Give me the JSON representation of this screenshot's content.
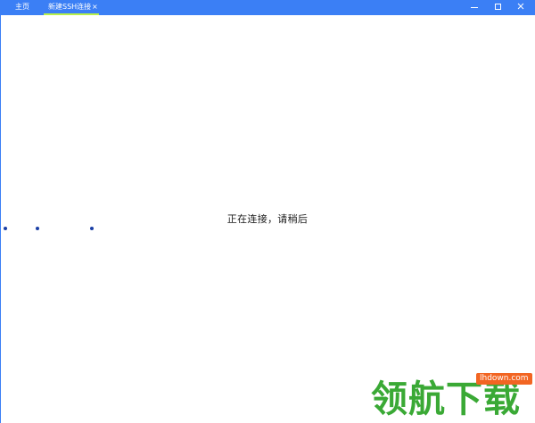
{
  "tabs": {
    "home_label": "主页",
    "ssh_label": "新建SSH连接",
    "close_glyph": "×"
  },
  "window_controls": {
    "minimize_icon": "minimize-icon",
    "maximize_icon": "maximize-icon",
    "close_icon": "close-icon"
  },
  "main": {
    "status_text": "正在连接，请稍后"
  },
  "watermark": {
    "url": "lhdown.com",
    "brand": "领航下载"
  },
  "colors": {
    "titlebar": "#3b7ff5",
    "active_tab_underline": "#b8f04a",
    "loading_dots": "#1a3fa6",
    "watermark_green": "#3aa935",
    "watermark_orange": "#f26522"
  }
}
